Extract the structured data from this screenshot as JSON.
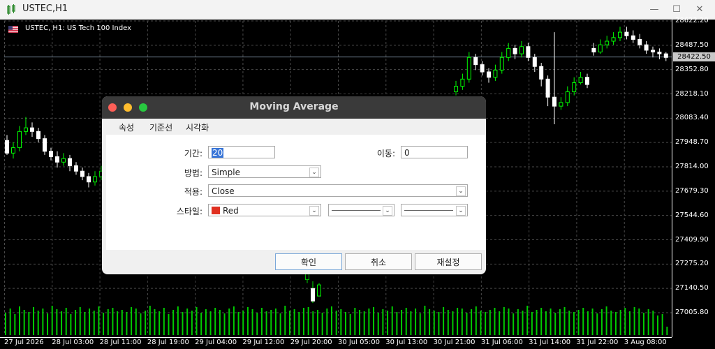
{
  "window": {
    "title": "USTEC,H1",
    "minimize_icon": "minimize-icon",
    "maximize_icon": "maximize-icon",
    "close_icon": "close-icon"
  },
  "chart": {
    "symbol_label": "USTEC, H1:  US Tech 100 Index",
    "current_price": "28422.50",
    "background": "#000000",
    "bull_color": "#00ff00",
    "bear_color": "#ffffff",
    "volume_color": "#00cc00"
  },
  "chart_data": {
    "type": "candlestick",
    "y_ticks": [
      "28622.20",
      "28487.50",
      "28352.80",
      "28218.10",
      "28083.40",
      "27948.70",
      "27814.00",
      "27679.30",
      "27544.60",
      "27409.90",
      "27275.20",
      "27140.50",
      "27005.80"
    ],
    "x_ticks": [
      "27 Jul 2026",
      "28 Jul 03:00",
      "28 Jul 11:00",
      "28 Jul 19:00",
      "29 Jul 04:00",
      "29 Jul 12:00",
      "29 Jul 20:00",
      "30 Jul 05:00",
      "30 Jul 13:00",
      "30 Jul 21:00",
      "31 Jul 06:00",
      "31 Jul 14:00",
      "31 Jul 22:00",
      "3 Aug 08:00"
    ],
    "ylim": [
      26990,
      28630
    ],
    "candles": [
      [
        27960,
        27890,
        27990,
        27880
      ],
      [
        27890,
        27920,
        27950,
        27860
      ],
      [
        27920,
        28010,
        28040,
        27900
      ],
      [
        28010,
        28030,
        28090,
        27990
      ],
      [
        28030,
        28010,
        28060,
        27980
      ],
      [
        28010,
        27970,
        28030,
        27950
      ],
      [
        27970,
        27900,
        27990,
        27880
      ],
      [
        27900,
        27870,
        27920,
        27850
      ],
      [
        27870,
        27840,
        27900,
        27810
      ],
      [
        27840,
        27860,
        27890,
        27820
      ],
      [
        27860,
        27820,
        27880,
        27790
      ],
      [
        27820,
        27790,
        27840,
        27770
      ],
      [
        27790,
        27760,
        27810,
        27740
      ],
      [
        27760,
        27730,
        27780,
        27700
      ],
      [
        27730,
        27760,
        27790,
        27710
      ],
      [
        27760,
        27790,
        27820,
        27740
      ],
      [
        27790,
        27780,
        27820,
        27760
      ]
    ],
    "candles_right": [
      [
        28230,
        28260,
        28290,
        28210
      ],
      [
        28260,
        28300,
        28330,
        28240
      ],
      [
        28300,
        28420,
        28450,
        28280
      ],
      [
        28420,
        28380,
        28440,
        28350
      ],
      [
        28380,
        28340,
        28400,
        28320
      ],
      [
        28340,
        28310,
        28360,
        28280
      ],
      [
        28310,
        28350,
        28380,
        28290
      ],
      [
        28350,
        28420,
        28450,
        28330
      ],
      [
        28420,
        28470,
        28500,
        28400
      ],
      [
        28470,
        28440,
        28490,
        28410
      ],
      [
        28440,
        28480,
        28510,
        28420
      ],
      [
        28480,
        28420,
        28500,
        28400
      ],
      [
        28420,
        28370,
        28440,
        28340
      ],
      [
        28370,
        28300,
        28390,
        28260
      ],
      [
        28300,
        28200,
        28320,
        28150
      ],
      [
        28200,
        28150,
        28560,
        28050
      ],
      [
        28150,
        28170,
        28200,
        28130
      ],
      [
        28170,
        28230,
        28260,
        28150
      ],
      [
        28230,
        28280,
        28310,
        28210
      ],
      [
        28280,
        28310,
        28340,
        28270
      ],
      [
        28310,
        28270,
        28330,
        28250
      ],
      [
        28470,
        28450,
        28500,
        28430
      ],
      [
        28450,
        28490,
        28520,
        28440
      ],
      [
        28490,
        28510,
        28540,
        28470
      ],
      [
        28510,
        28530,
        28560,
        28490
      ],
      [
        28530,
        28560,
        28590,
        28510
      ],
      [
        28560,
        28540,
        28590,
        28520
      ],
      [
        28540,
        28520,
        28570,
        28500
      ],
      [
        28520,
        28490,
        28550,
        28470
      ],
      [
        28490,
        28460,
        28510,
        28440
      ],
      [
        28460,
        28450,
        28480,
        28420
      ],
      [
        28450,
        28440,
        28470,
        28410
      ],
      [
        28440,
        28420,
        28450,
        28400
      ]
    ],
    "volumes": [
      32,
      38,
      30,
      41,
      36,
      33,
      40,
      35,
      38,
      31,
      42,
      37,
      34,
      39,
      30,
      36,
      40,
      33,
      38,
      35,
      41,
      32,
      37,
      39,
      34,
      36,
      33,
      40,
      38,
      31,
      35,
      42,
      37,
      34,
      39,
      30,
      36,
      41,
      33,
      38,
      35,
      40,
      32,
      37,
      34,
      39,
      36,
      31,
      38,
      41,
      33,
      35,
      40,
      37,
      32,
      39,
      34,
      36,
      38,
      31,
      42,
      35,
      37,
      33,
      39,
      40,
      34,
      36,
      32,
      38,
      41,
      35,
      37,
      33,
      30,
      39,
      36,
      34,
      38,
      40,
      32,
      37,
      35,
      41,
      33,
      36,
      39,
      34,
      38,
      31,
      42,
      37,
      35,
      33,
      40,
      36,
      34,
      39,
      38,
      32,
      37,
      41,
      35,
      33,
      36,
      39,
      34,
      40,
      38,
      31,
      37,
      35,
      42,
      33,
      36,
      39,
      34,
      38,
      32,
      37,
      40,
      35,
      33,
      36,
      39,
      34,
      38,
      31,
      37,
      41,
      35,
      33,
      36,
      39,
      34,
      40,
      38,
      32,
      37,
      35,
      28,
      30,
      12
    ]
  },
  "dialog": {
    "title": "Moving Average",
    "tabs": [
      "속성",
      "기준선",
      "시각화"
    ],
    "labels": {
      "period": "기간:",
      "shift": "이동:",
      "method": "방법:",
      "apply": "적용:",
      "style": "스타일:"
    },
    "values": {
      "period": "20",
      "shift": "0",
      "method": "Simple",
      "apply": "Close",
      "style_color": "Red",
      "style_color_hex": "#e03020"
    },
    "buttons": {
      "ok": "확인",
      "cancel": "취소",
      "reset": "재설정"
    },
    "traffic_lights": {
      "red": "#fe5f57",
      "yellow": "#febc2e",
      "green": "#28c840"
    }
  }
}
